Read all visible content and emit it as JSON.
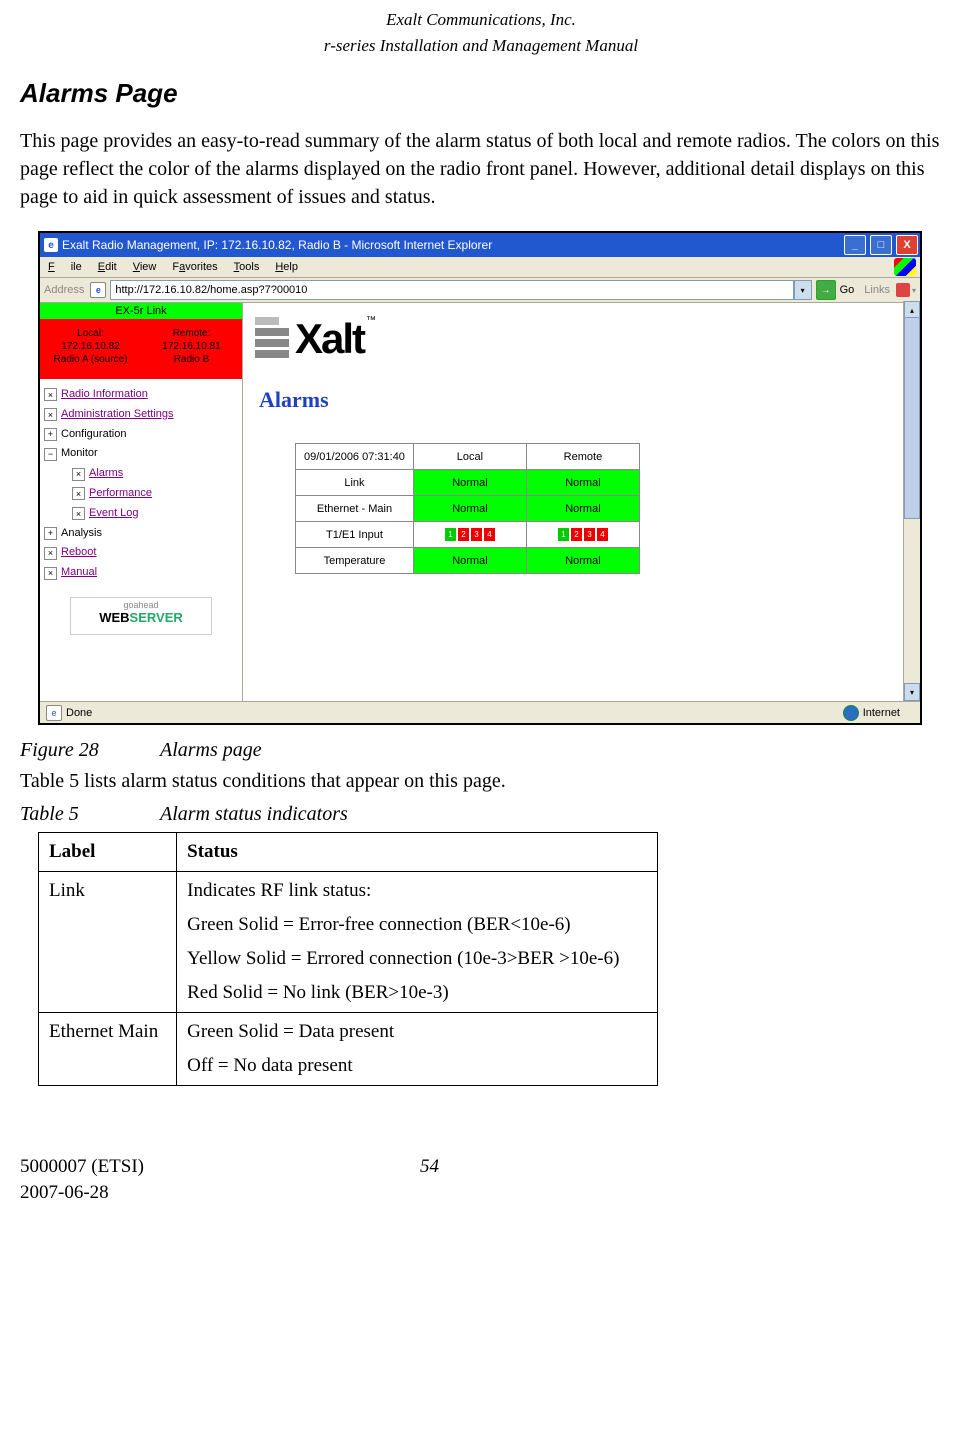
{
  "header": {
    "company": "Exalt Communications, Inc.",
    "manual": "r-series Installation and Management Manual"
  },
  "section_title": "Alarms Page",
  "intro_text": "This page provides an easy-to-read summary of the alarm status of both local and remote radios. The colors on this page reflect the color of the alarms displayed on the radio front panel. However, additional detail displays on this page to aid in quick assessment of issues and status.",
  "screenshot": {
    "titlebar": "Exalt Radio Management, IP: 172.16.10.82, Radio B - Microsoft Internet Explorer",
    "menus": {
      "file": "File",
      "edit": "Edit",
      "view": "View",
      "favorites": "Favorites",
      "tools": "Tools",
      "help": "Help"
    },
    "address_label": "Address",
    "address_value": "http://172.16.10.82/home.asp?7?00010",
    "go_label": "Go",
    "links_label": "Links",
    "link_name": "EX-5r Link",
    "local_box": {
      "l1": "Local:",
      "l2": "172.16.10.82",
      "l3": "Radio A (source)"
    },
    "remote_box": {
      "l1": "Remote:",
      "l2": "172.16.10.81",
      "l3": "Radio B"
    },
    "nav": {
      "radio_info": "Radio Information",
      "admin": "Administration Settings",
      "config": "Configuration",
      "monitor": "Monitor",
      "alarms": "Alarms",
      "perf": "Performance",
      "eventlog": "Event Log",
      "analysis": "Analysis",
      "reboot": "Reboot",
      "manual": "Manual"
    },
    "webserver": {
      "small": "goahead",
      "big_a": "WEB",
      "big_b": "SERVER"
    },
    "logo_text": "Xalt",
    "page_heading": "Alarms",
    "table": {
      "timestamp": "09/01/2006 07:31:40",
      "col_local": "Local",
      "col_remote": "Remote",
      "row_link": "Link",
      "row_eth": "Ethernet - Main",
      "row_t1": "T1/E1 Input",
      "row_temp": "Temperature",
      "normal": "Normal",
      "t1_local": [
        "1",
        "2",
        "3",
        "4"
      ],
      "t1_local_state": [
        "g",
        "r",
        "r",
        "r"
      ],
      "t1_remote": [
        "1",
        "2",
        "3",
        "4"
      ],
      "t1_remote_state": [
        "g",
        "r",
        "r",
        "r"
      ]
    },
    "status_done": "Done",
    "status_internet": "Internet"
  },
  "figure": {
    "num": "Figure 28",
    "title": "Alarms page"
  },
  "table_ref": "Table 5 lists alarm status conditions that appear on this page.",
  "table_caption": {
    "num": "Table 5",
    "title": "Alarm status indicators"
  },
  "status_table": {
    "h1": "Label",
    "h2": "Status",
    "rows": [
      {
        "label": "Link",
        "lines": [
          "Indicates RF link status:",
          "Green Solid = Error-free connection (BER<10e-6)",
          "Yellow Solid = Errored connection (10e-3>BER >10e-6)",
          "Red Solid = No link (BER>10e-3)"
        ]
      },
      {
        "label": "Ethernet Main",
        "lines": [
          "Green Solid = Data present",
          "Off = No data present"
        ]
      }
    ]
  },
  "footer": {
    "docnum": "5000007 (ETSI)",
    "page": "54",
    "date": "2007-06-28"
  }
}
